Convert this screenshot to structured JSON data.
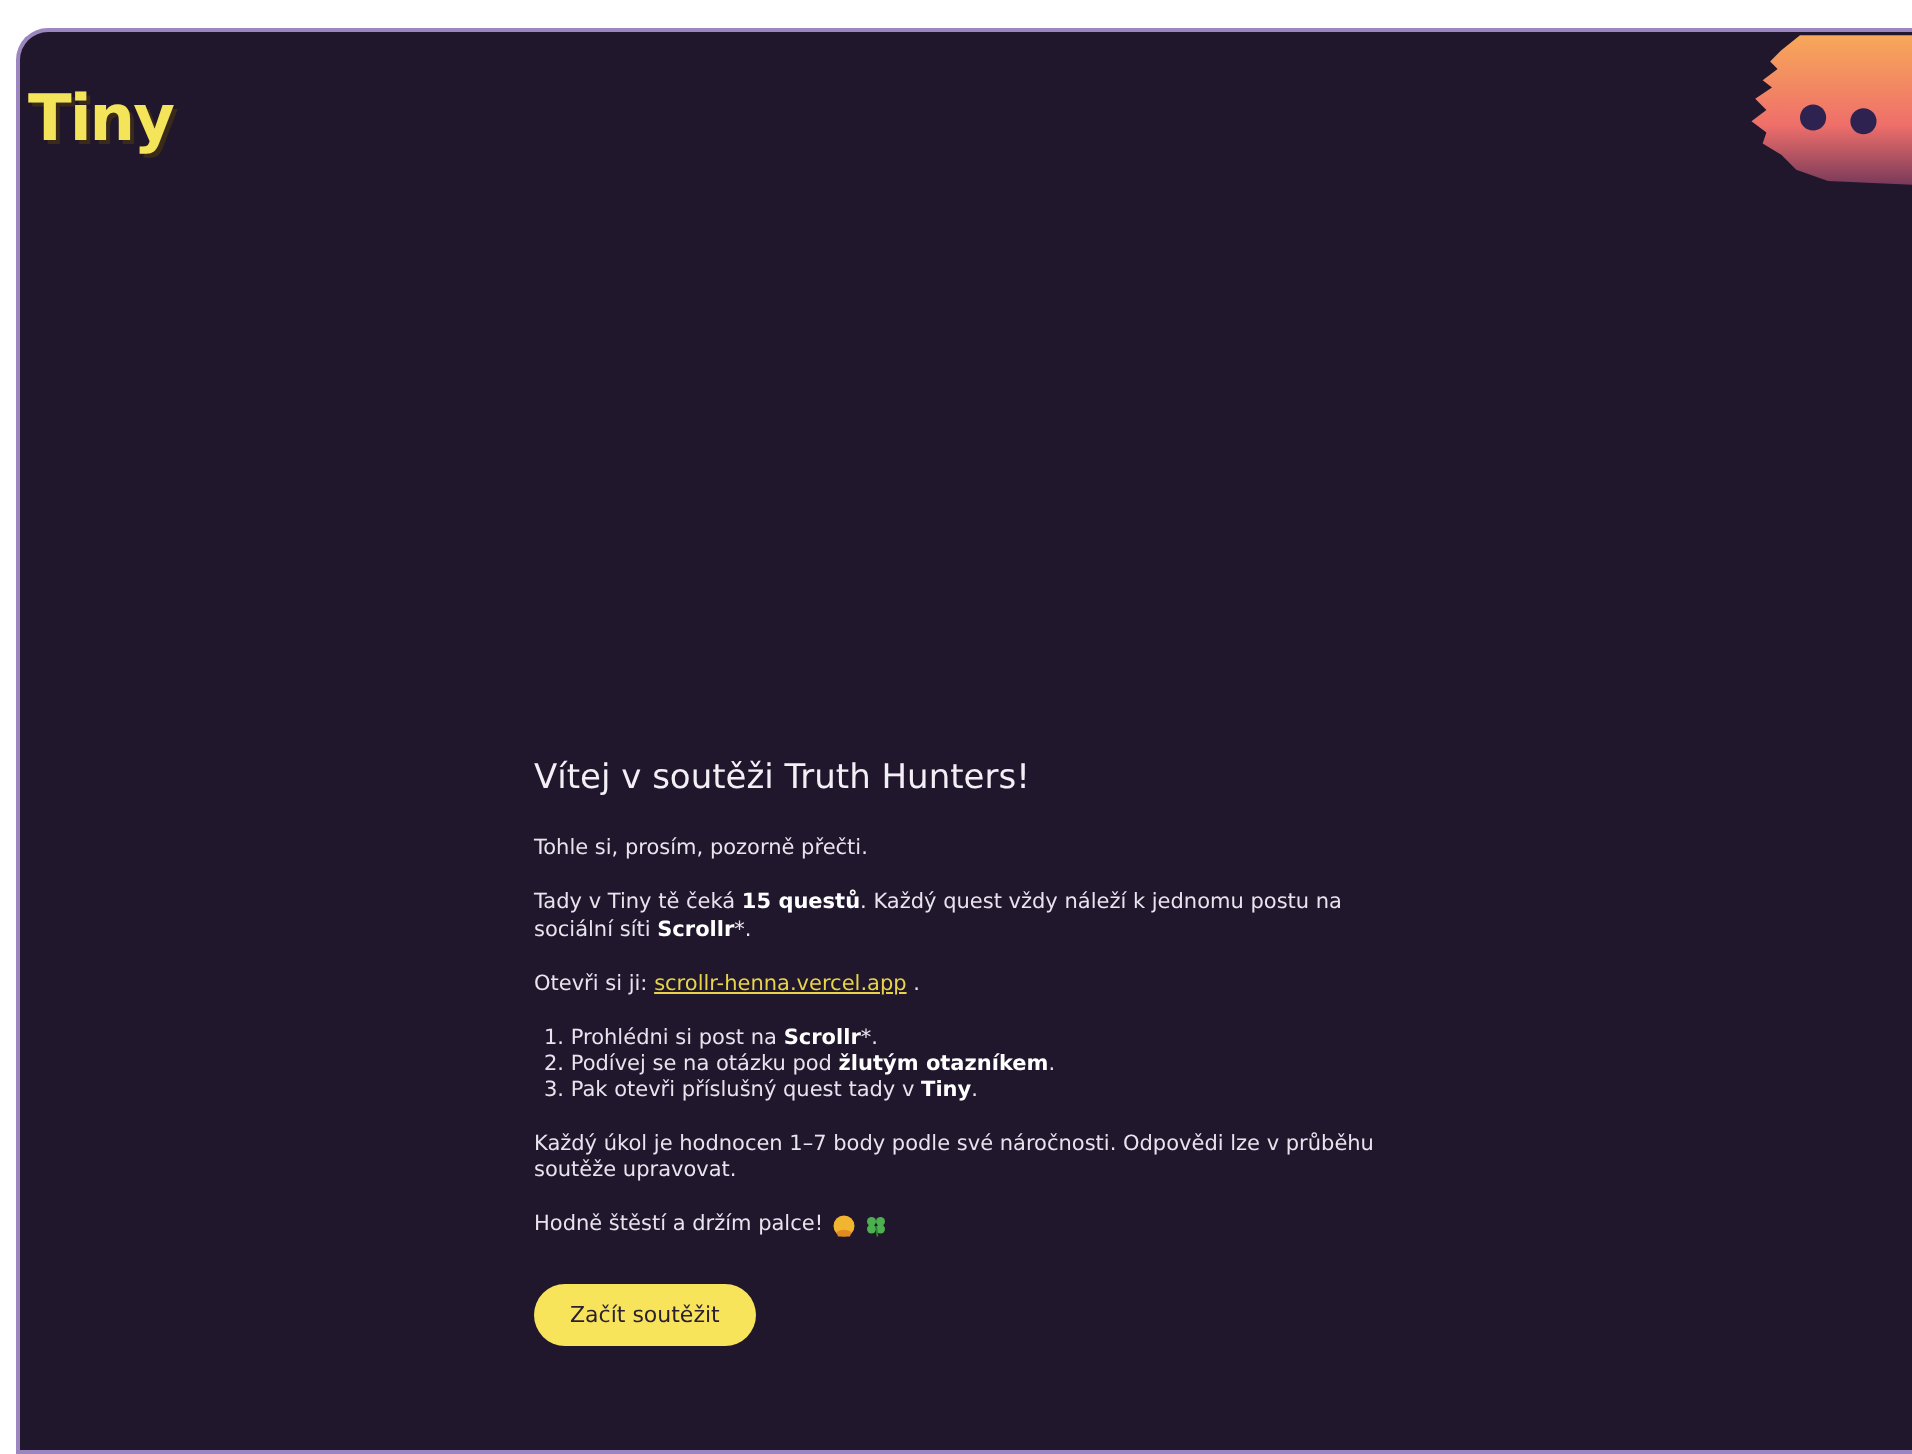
{
  "logo": "Tiny",
  "title": "Vítej v soutěži Truth Hunters!",
  "intro": "Tohle si, prosím, pozorně přečti.",
  "quests_text": "Tady v Tiny tě čeká **15 questů**. Každý quest vždy náleží k jednomu postu na sociální síti **Scrollr***.",
  "open_text": {
    "before": "Otevři si ji:",
    "link": "scrollr-henna.vercel.app",
    "after": "."
  },
  "steps": [
    {
      "number": "1.",
      "text": "Prohlédni si post na **Scrollr***."
    },
    {
      "number": "2.",
      "text": "Podívej se na otázku pod **žlutým otazníkem**."
    },
    {
      "number": "3.",
      "text": "Pak otevři příslušný quest tady v **Tiny**."
    }
  ],
  "scoring_text": "Každý úkol je hodnocen 1–7 body podle své náročnosti. Odpovědi lze v průběhu soutěže upravovat.",
  "farewell": "Hodně štěstí a držím palce!",
  "start_button": "Začít soutěžit"
}
